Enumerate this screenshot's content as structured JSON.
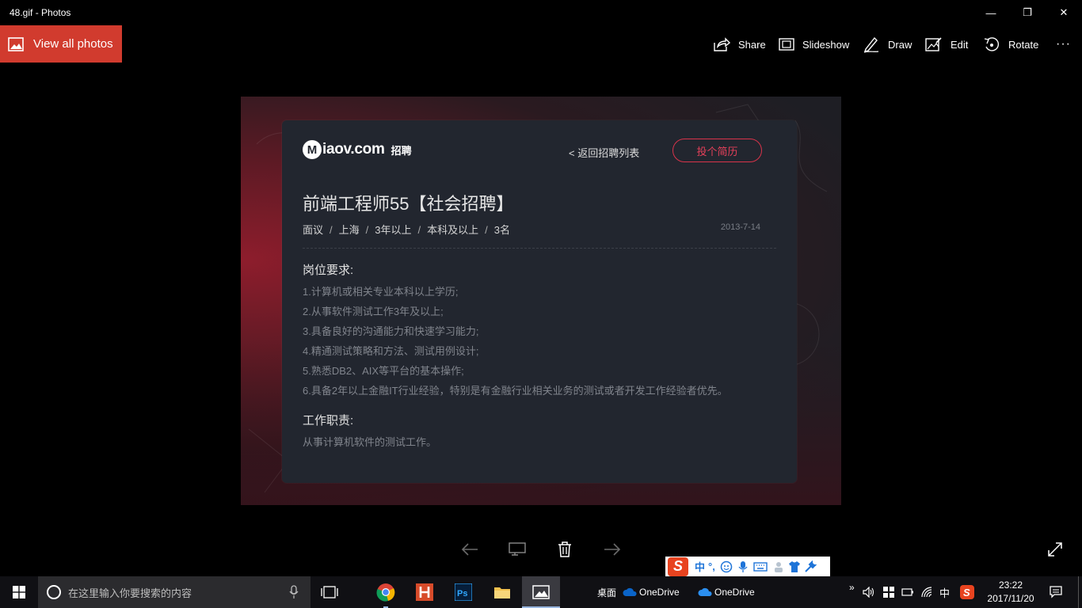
{
  "window": {
    "title": "48.gif - Photos",
    "minimize_glyph": "—",
    "restore_glyph": "❐",
    "close_glyph": "✕"
  },
  "commandbar": {
    "view_all": "View all photos",
    "share": "Share",
    "slideshow": "Slideshow",
    "draw": "Draw",
    "edit": "Edit",
    "rotate": "Rotate",
    "more": "···"
  },
  "image": {
    "logo_letter": "M",
    "logo_brand": "iaov.com",
    "logo_sub": "招聘",
    "back_link": "< 返回招聘列表",
    "apply_button": "投个简历",
    "job_title": "前端工程师55【社会招聘】",
    "meta": [
      "面议",
      "上海",
      "3年以上",
      "本科及以上",
      "3名"
    ],
    "meta_sep": "/",
    "date": "2013-7-14",
    "requirements_heading": "岗位要求:",
    "requirements": [
      "1.计算机或相关专业本科以上学历;",
      "2.从事软件测试工作3年及以上;",
      "3.具备良好的沟通能力和快速学习能力;",
      "4.精通测试策略和方法、测试用例设计;",
      "5.熟悉DB2、AIX等平台的基本操作;",
      "6.具备2年以上金融IT行业经验，特别是有金融行业相关业务的测试或者开发工作经验者优先。"
    ],
    "duties_heading": "工作职责:",
    "duties": "从事计算机软件的测试工作。"
  },
  "ime": {
    "logo": "S",
    "lang": "中",
    "punct": "°,"
  },
  "taskbar": {
    "search_placeholder": "在这里输入你要搜索的内容",
    "desktop_label": "桌面",
    "onedrive1": "OneDrive",
    "onedrive2": "OneDrive",
    "chevron": "»",
    "lang": "中",
    "time": "23:22",
    "date": "2017/11/20"
  },
  "colors": {
    "accent": "#d13b2e",
    "apply_red": "#e4405a",
    "card_bg": "#22262f"
  }
}
